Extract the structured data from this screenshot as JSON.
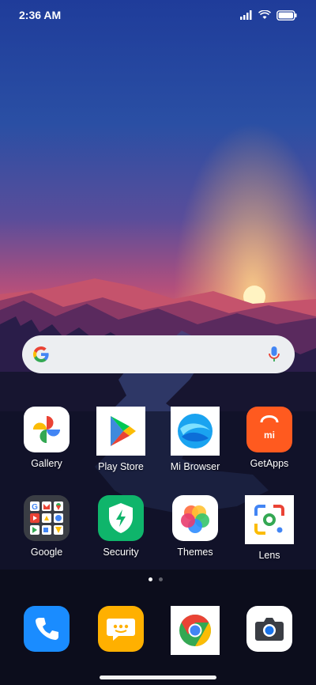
{
  "status_bar": {
    "time": "2:36 AM",
    "icons": [
      "signal-icon",
      "wifi-icon",
      "battery-icon"
    ]
  },
  "search_bar": {
    "icons": [
      "google-g-icon",
      "microphone-icon"
    ],
    "colors": {
      "background": "#eceef1",
      "mic": "#4285F4"
    }
  },
  "home": {
    "row1": [
      {
        "label": "Gallery",
        "icon": "gallery-pinwheel-icon"
      },
      {
        "label": "Play Store",
        "icon": "play-store-icon"
      },
      {
        "label": "Mi Browser",
        "icon": "mi-browser-icon"
      },
      {
        "label": "GetApps",
        "icon": "getapps-bag-icon"
      }
    ],
    "row2": [
      {
        "label": "Google",
        "icon": "google-folder-icon"
      },
      {
        "label": "Security",
        "icon": "security-shield-icon"
      },
      {
        "label": "Themes",
        "icon": "themes-petals-icon"
      },
      {
        "label": "Lens",
        "icon": "lens-icon"
      }
    ],
    "page_indicator": {
      "pages": 2,
      "current": 1
    }
  },
  "dock": [
    {
      "name": "phone",
      "icon": "phone-icon"
    },
    {
      "name": "messages",
      "icon": "message-icon"
    },
    {
      "name": "chrome",
      "icon": "chrome-icon"
    },
    {
      "name": "camera",
      "icon": "camera-icon"
    }
  ],
  "colors": {
    "getapps": "#ff5a1f",
    "security": "#0fb56b",
    "phone": "#1a8cff",
    "messages": "#ffb000"
  }
}
